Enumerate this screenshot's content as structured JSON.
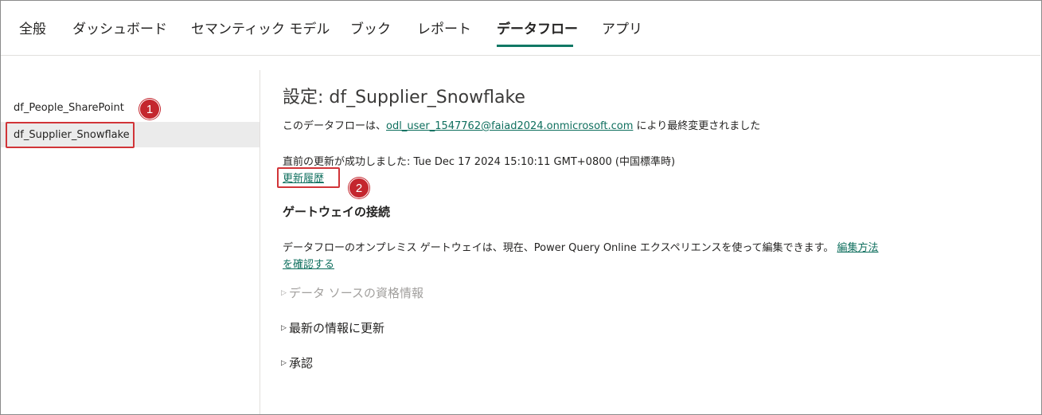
{
  "tabs": [
    {
      "label": "全般",
      "active": false
    },
    {
      "label": "ダッシュボード",
      "active": false
    },
    {
      "label": "セマンティック モデル",
      "active": false
    },
    {
      "label": "ブック",
      "active": false
    },
    {
      "label": "レポート",
      "active": false
    },
    {
      "label": "データフロー",
      "active": true
    },
    {
      "label": "アプリ",
      "active": false
    }
  ],
  "sidebar": {
    "items": [
      {
        "label": "df_People_SharePoint",
        "selected": false
      },
      {
        "label": "df_Supplier_Snowflake",
        "selected": true
      }
    ]
  },
  "badges": {
    "one": "1",
    "two": "2"
  },
  "main": {
    "title": "設定: df_Supplier_Snowflake",
    "modified_prefix": "このデータフローは、",
    "modified_user": "odl_user_1547762@faiad2024.onmicrosoft.com",
    "modified_suffix": " により最終変更されました",
    "last_refresh": "直前の更新が成功しました: Tue Dec 17 2024 15:10:11 GMT+0800 (中国標準時)",
    "refresh_history_link": "更新履歴",
    "gateway_heading": "ゲートウェイの接続",
    "gateway_text": "データフローのオンプレミス ゲートウェイは、現在、Power Query Online エクスペリエンスを使って編集できます。 ",
    "gateway_link_part1": "編集方法",
    "gateway_link_part2": "を確認する",
    "expanders": [
      {
        "label": "データ ソースの資格情報",
        "disabled": true
      },
      {
        "label": "最新の情報に更新",
        "disabled": false
      },
      {
        "label": "承認",
        "disabled": false
      }
    ]
  },
  "colors": {
    "accent": "#117865",
    "link": "#0f6f5e",
    "annotation": "#c4262e",
    "selected_bg": "#ebebeb"
  }
}
